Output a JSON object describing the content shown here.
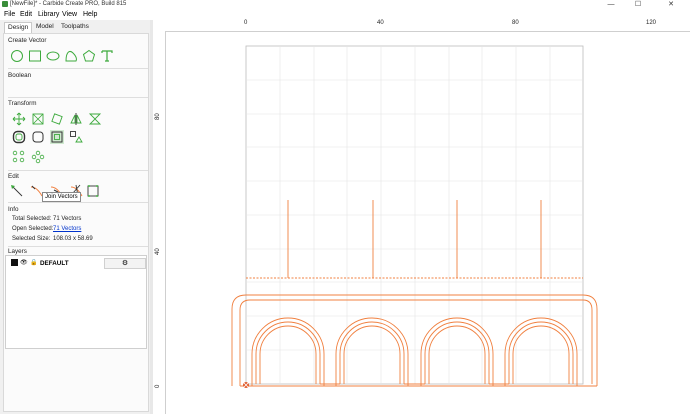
{
  "window": {
    "title": "[NewFile]* - Carbide Create PRO, Build 815",
    "min": "—",
    "max": "☐",
    "close": "✕"
  },
  "menu": {
    "file": "File",
    "edit": "Edit",
    "library": "Library",
    "view": "View",
    "help": "Help"
  },
  "tabs": {
    "design": "Design",
    "model": "Model",
    "toolpaths": "Toolpaths",
    "active": "Design"
  },
  "panel": {
    "create_vector": "Create Vector",
    "boolean": "Boolean",
    "transform": "Transform",
    "edit": "Edit",
    "tooltip": "Join Vectors",
    "info_title": "Info",
    "total_selected_label": "Total Selected:",
    "total_selected_value": "71 Vectors",
    "open_selected_label": "Open Selected:",
    "open_selected_value": "71 Vectors",
    "selected_size_label": "Selected Size:",
    "selected_size_value": "108.03 x 58.69",
    "layers_title": "Layers",
    "layer_name": "DEFAULT",
    "gear": "⚙"
  },
  "rulers": {
    "top": [
      "0",
      "40",
      "80",
      "120"
    ],
    "left": [
      "80",
      "40",
      "0"
    ]
  },
  "colors": {
    "accent": "#3daa3d",
    "vector": "#f08040",
    "selection": "#e05a2b"
  }
}
